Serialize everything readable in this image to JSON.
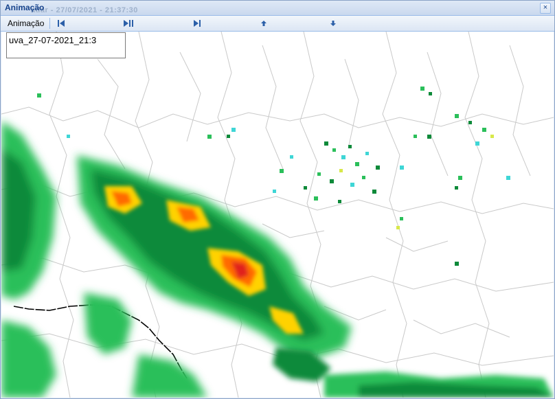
{
  "window": {
    "title": "Animação",
    "ghost_title": "adar - 27/07/2021 - 21:37:30",
    "close_label": "×"
  },
  "toolbar": {
    "label": "Animação",
    "buttons": [
      {
        "name": "first-frame",
        "icon": "skip-back-icon"
      },
      {
        "name": "play-pause",
        "icon": "play-pause-icon"
      },
      {
        "name": "next-frame",
        "icon": "step-forward-icon"
      },
      {
        "name": "speed-up",
        "icon": "arrow-up-icon"
      },
      {
        "name": "speed-down",
        "icon": "arrow-down-icon"
      }
    ]
  },
  "file_name": {
    "value": "uva_27-07-2021_21:3"
  },
  "colors": {
    "accent": "#15428b",
    "rain_light": "#2bbf5a",
    "rain_medium": "#0e8a3a",
    "rain_heavy": "#ffd200",
    "rain_very_heavy": "#ff6a00",
    "rain_extreme": "#e0201a",
    "cyan_edge": "#3fd6d6"
  }
}
